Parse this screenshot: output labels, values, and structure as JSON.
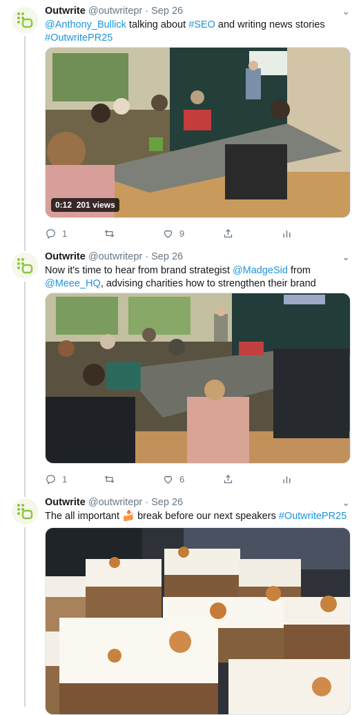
{
  "tweets": [
    {
      "name": "Outwrite",
      "handle": "@outwritepr",
      "separator": "·",
      "date": "Sep 26",
      "text_parts": [
        {
          "t": "@Anthony_Bullick",
          "link": true
        },
        {
          "t": " talking about ",
          "link": false
        },
        {
          "t": "#SEO",
          "link": true
        },
        {
          "t": " and writing news stories ",
          "link": false
        },
        {
          "t": "#OutwritePR25",
          "link": true
        }
      ],
      "media_type": "video",
      "video_time": "0:12",
      "video_views": "201 views",
      "replies": "1",
      "retweets": "",
      "likes": "9"
    },
    {
      "name": "Outwrite",
      "handle": "@outwritepr",
      "separator": "·",
      "date": "Sep 26",
      "text_parts": [
        {
          "t": "Now it's time to hear from brand strategist ",
          "link": false
        },
        {
          "t": "@MadgeSid",
          "link": true
        },
        {
          "t": " from ",
          "link": false
        },
        {
          "t": "@Meee_HQ",
          "link": true
        },
        {
          "t": ", advising charities how to strengthen their brand",
          "link": false
        }
      ],
      "media_type": "photo",
      "replies": "1",
      "retweets": "",
      "likes": "6"
    },
    {
      "name": "Outwrite",
      "handle": "@outwritepr",
      "separator": "·",
      "date": "Sep 26",
      "text_parts": [
        {
          "t": "The all important ",
          "link": false
        },
        {
          "t": "🍰",
          "link": false
        },
        {
          "t": " break before our next speakers ",
          "link": false
        },
        {
          "t": "#OutwritePR25",
          "link": true
        }
      ],
      "media_type": "photo"
    }
  ],
  "icons": {
    "reply": "reply-icon",
    "retweet": "retweet-icon",
    "like": "heart-icon",
    "share": "share-icon",
    "analytics": "analytics-icon",
    "more": "chevron-down-icon"
  },
  "colors": {
    "link": "#1b95e0",
    "secondary_text": "#657786",
    "brand_green": "#8dc63f"
  }
}
